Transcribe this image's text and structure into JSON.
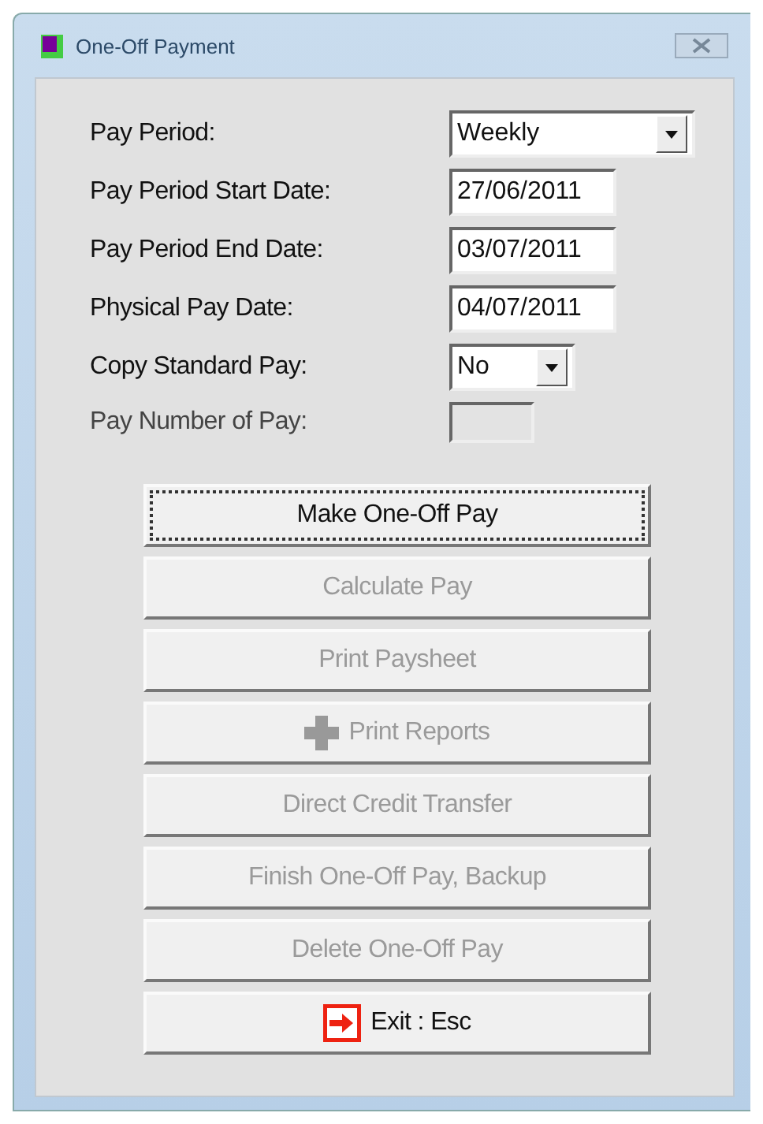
{
  "window": {
    "title": "One-Off Payment"
  },
  "fields": [
    {
      "label": "Pay Period:",
      "kind": "select",
      "value": "Weekly",
      "disabled": false
    },
    {
      "label": "Pay Period Start Date:",
      "kind": "text",
      "value": "27/06/2011",
      "disabled": false
    },
    {
      "label": "Pay Period End Date:",
      "kind": "text",
      "value": "03/07/2011",
      "disabled": false
    },
    {
      "label": "Physical Pay Date:",
      "kind": "text",
      "value": "04/07/2011",
      "disabled": false
    },
    {
      "label": "Copy Standard Pay:",
      "kind": "select-small",
      "value": "No",
      "disabled": false
    },
    {
      "label": "Pay Number of Pay:",
      "kind": "text-small",
      "disabled": true
    }
  ],
  "buttons": [
    {
      "label": "Make One-Off Pay",
      "disabled": false,
      "focused": true
    },
    {
      "label": "Calculate Pay",
      "disabled": true,
      "focused": false
    },
    {
      "label": "Print Paysheet",
      "disabled": true,
      "focused": false
    },
    {
      "label": "Print Reports",
      "disabled": true,
      "focused": false,
      "kind": "plus"
    },
    {
      "label": "Direct Credit Transfer",
      "disabled": true,
      "focused": false
    },
    {
      "label": "Finish One-Off Pay, Backup",
      "disabled": true,
      "focused": false
    },
    {
      "label": "Delete One-Off Pay",
      "disabled": true,
      "focused": false
    },
    {
      "label": "Exit : Esc",
      "disabled": false,
      "focused": false,
      "kind": "exit"
    }
  ]
}
